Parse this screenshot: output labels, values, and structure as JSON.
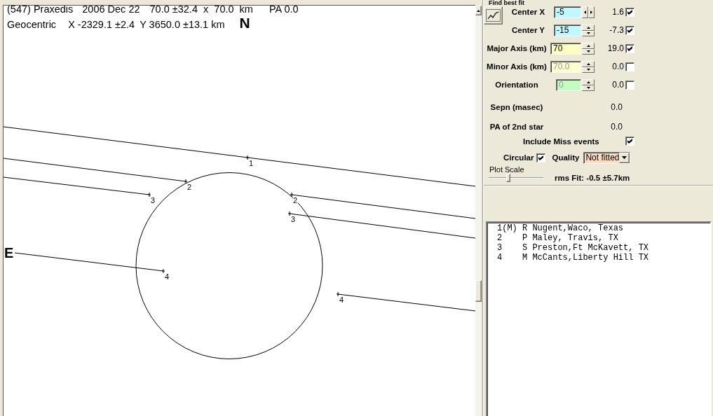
{
  "plot": {
    "title_parts": [
      "(547) Praxedis",
      "2006 Dec 22",
      "70.0 ±32.4  x  70.0  km",
      "PA 0.0"
    ],
    "position_parts": [
      "Geocentric",
      "X -2329.1 ±2.4",
      "Y 3650.0 ±13.1 km"
    ],
    "north_label": "N",
    "east_label": "E",
    "chords": [
      {
        "kind": "miss",
        "labels": [
          "1"
        ]
      },
      {
        "kind": "hit",
        "labels": [
          "2",
          "2"
        ]
      },
      {
        "kind": "hit",
        "labels": [
          "3",
          "3"
        ]
      },
      {
        "kind": "hit",
        "labels": [
          "4",
          "4"
        ]
      }
    ]
  },
  "fit_panel": {
    "title": "Find best fit",
    "parameters": [
      {
        "kind": "horizontal",
        "label": "Center X",
        "value": "-5",
        "color": "#bff8ff",
        "disabled": false,
        "result": "1.6",
        "checked": true
      },
      {
        "kind": "vertical",
        "label": "Center Y",
        "value": "-15",
        "color": "#bff8ff",
        "disabled": false,
        "result": "-7.3",
        "checked": true
      },
      {
        "kind": "vertical",
        "label": "Major Axis (km)",
        "value": "70",
        "color": "#ffffc0",
        "disabled": false,
        "result": "19.0",
        "checked": true
      },
      {
        "kind": "vertical",
        "label": "Minor Axis (km)",
        "value": "70.0",
        "color": "#ffffd0",
        "disabled": true,
        "result": "0.0",
        "checked": false
      },
      {
        "kind": "vertical",
        "label": "Orientation",
        "value": "0",
        "color": "#c0ffc0",
        "disabled": true,
        "result": "0.0",
        "checked": false
      }
    ],
    "readouts": [
      {
        "label": "Sepn (masec)",
        "value": "0.0"
      },
      {
        "label": "PA of 2nd star",
        "value": "0.0"
      }
    ],
    "include_miss": {
      "label": "Include Miss events",
      "checked": true
    },
    "circular": {
      "label": "Circular",
      "checked": true
    },
    "quality": {
      "label": "Quality",
      "value": "Not fitted"
    },
    "plot_scale": {
      "label": "Plot Scale",
      "level": 0.35
    },
    "rms_fit": "rms Fit: -0.5 ±5.7km"
  },
  "observers": [
    {
      "text": "1(M) R Nugent,Waco, Texas",
      "selected": false
    },
    {
      "text": "2    P Maley, Travis, TX",
      "selected": false
    },
    {
      "text": "3    S Preston,Ft McKavett, TX",
      "selected": false
    },
    {
      "text": "4    M McCants,Liberty Hill TX",
      "selected": false
    }
  ]
}
